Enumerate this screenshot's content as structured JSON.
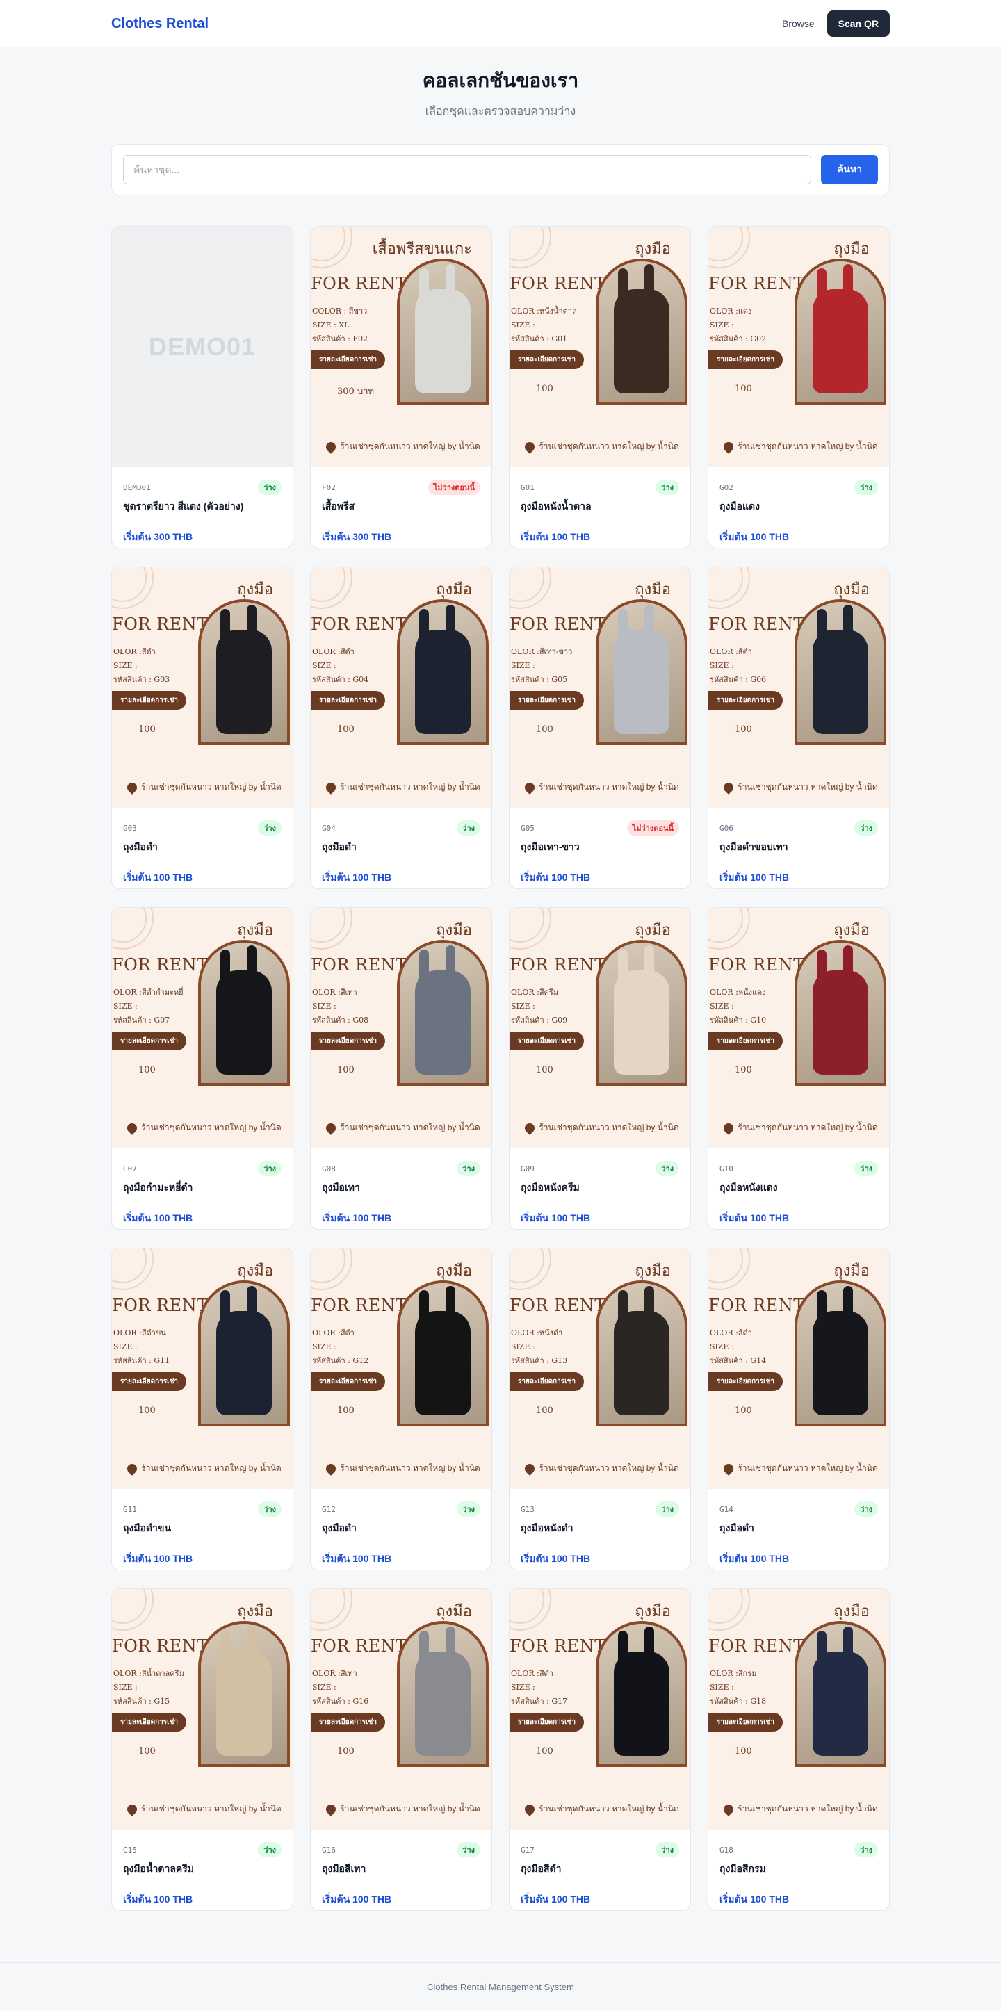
{
  "header": {
    "brand": "Clothes Rental",
    "browse_label": "Browse",
    "scan_label": "Scan QR"
  },
  "hero": {
    "title": "คอลเลกชันของเรา",
    "subtitle": "เลือกชุดและตรวจสอบความว่าง"
  },
  "search": {
    "placeholder": "ค้นหาชุด...",
    "button_label": "ค้นหา"
  },
  "poster": {
    "for_rent": "FOR RENT",
    "pill": "รายละเอียดการเช่า",
    "shop": "ร้านเช่าชุดกันหนาว หาดใหญ่ by น้ำนิด",
    "title_gloves": "ถุงมือ"
  },
  "items": [
    {
      "code": "DEMO01",
      "name": "ชุดราตรียาว สีแดง (ตัวอย่าง)",
      "status": "ว่าง",
      "available": true,
      "price": "เริ่มต้น 300 THB",
      "demo": true,
      "demo_text": "DEMO01"
    },
    {
      "code": "F02",
      "name": "เสื้อพรีส",
      "status": "ไม่ว่างตอนนี้",
      "available": false,
      "price": "เริ่มต้น 300 THB",
      "poster_title": "เสื้อพรีสขนแกะ",
      "color": "#d9d9d6",
      "poster_lines": [
        "COLOR : สีขาว",
        "SIZE : XL",
        "รหัสสินค้า : F02"
      ],
      "poster_price": "300 บาท"
    },
    {
      "code": "G01",
      "name": "ถุงมือหนังน้ำตาล",
      "status": "ว่าง",
      "available": true,
      "price": "เริ่มต้น 100 THB",
      "color": "#3b2a22",
      "poster_lines": [
        "OLOR :หนังน้ำตาล",
        "SIZE :",
        "รหัสสินค้า : G01"
      ],
      "poster_price": "100"
    },
    {
      "code": "G02",
      "name": "ถุงมือแดง",
      "status": "ว่าง",
      "available": true,
      "price": "เริ่มต้น 100 THB",
      "color": "#b3262b",
      "poster_lines": [
        "OLOR :แดง",
        "SIZE :",
        "รหัสสินค้า : G02"
      ],
      "poster_price": "100"
    },
    {
      "code": "G03",
      "name": "ถุงมือดำ",
      "status": "ว่าง",
      "available": true,
      "price": "เริ่มต้น 100 THB",
      "color": "#1e1e22",
      "poster_lines": [
        "OLOR :สีดำ",
        "SIZE :",
        "รหัสสินค้า : G03"
      ],
      "poster_price": "100"
    },
    {
      "code": "G04",
      "name": "ถุงมือดำ",
      "status": "ว่าง",
      "available": true,
      "price": "เริ่มต้น 100 THB",
      "color": "#1c2230",
      "poster_lines": [
        "OLOR :สีดำ",
        "SIZE :",
        "รหัสสินค้า : G04"
      ],
      "poster_price": "100"
    },
    {
      "code": "G05",
      "name": "ถุงมือเทา-ขาว",
      "status": "ไม่ว่างตอนนี้",
      "available": false,
      "price": "เริ่มต้น 100 THB",
      "color": "#b9bcc2",
      "poster_lines": [
        "OLOR :สีเทา-ขาว",
        "SIZE :",
        "รหัสสินค้า : G05"
      ],
      "poster_price": "100"
    },
    {
      "code": "G06",
      "name": "ถุงมือดำขอบเทา",
      "status": "ว่าง",
      "available": true,
      "price": "เริ่มต้น 100 THB",
      "color": "#1f2433",
      "poster_lines": [
        "OLOR :สีดำ",
        "SIZE :",
        "รหัสสินค้า : G06"
      ],
      "poster_price": "100"
    },
    {
      "code": "G07",
      "name": "ถุงมือกำมะหยี่ดำ",
      "status": "ว่าง",
      "available": true,
      "price": "เริ่มต้น 100 THB",
      "color": "#15161a",
      "poster_lines": [
        "OLOR :สีดำกำมะหยี่",
        "SIZE :",
        "รหัสสินค้า : G07"
      ],
      "poster_price": "100"
    },
    {
      "code": "G08",
      "name": "ถุงมือเทา",
      "status": "ว่าง",
      "available": true,
      "price": "เริ่มต้น 100 THB",
      "color": "#6b7280",
      "poster_lines": [
        "OLOR :สีเทา",
        "SIZE :",
        "รหัสสินค้า : G08"
      ],
      "poster_price": "100"
    },
    {
      "code": "G09",
      "name": "ถุงมือหนังครีม",
      "status": "ว่าง",
      "available": true,
      "price": "เริ่มต้น 100 THB",
      "color": "#e4d6c4",
      "poster_lines": [
        "OLOR :สีครีม",
        "SIZE :",
        "รหัสสินค้า : G09"
      ],
      "poster_price": "100"
    },
    {
      "code": "G10",
      "name": "ถุงมือหนังแดง",
      "status": "ว่าง",
      "available": true,
      "price": "เริ่มต้น 100 THB",
      "color": "#8d1f2d",
      "poster_lines": [
        "OLOR :หนังแดง",
        "SIZE :",
        "รหัสสินค้า : G10"
      ],
      "poster_price": "100"
    },
    {
      "code": "G11",
      "name": "ถุงมือดำขน",
      "status": "ว่าง",
      "available": true,
      "price": "เริ่มต้น 100 THB",
      "color": "#1d2233",
      "poster_lines": [
        "OLOR :สีดำขน",
        "SIZE :",
        "รหัสสินค้า : G11"
      ],
      "poster_price": "100"
    },
    {
      "code": "G12",
      "name": "ถุงมือดำ",
      "status": "ว่าง",
      "available": true,
      "price": "เริ่มต้น 100 THB",
      "color": "#141414",
      "poster_lines": [
        "OLOR :สีดำ",
        "SIZE :",
        "รหัสสินค้า : G12"
      ],
      "poster_price": "100"
    },
    {
      "code": "G13",
      "name": "ถุงมือหนังดำ",
      "status": "ว่าง",
      "available": true,
      "price": "เริ่มต้น 100 THB",
      "color": "#2a2624",
      "poster_lines": [
        "OLOR :หนังดำ",
        "SIZE :",
        "รหัสสินค้า : G13"
      ],
      "poster_price": "100"
    },
    {
      "code": "G14",
      "name": "ถุงมือดำ",
      "status": "ว่าง",
      "available": true,
      "price": "เริ่มต้น 100 THB",
      "color": "#15171c",
      "poster_lines": [
        "OLOR :สีดำ",
        "SIZE :",
        "รหัสสินค้า : G14"
      ],
      "poster_price": "100"
    },
    {
      "code": "G15",
      "name": "ถุงมือน้ำตาลครีม",
      "status": "ว่าง",
      "available": true,
      "price": "เริ่มต้น 100 THB",
      "color": "#d2c0a4",
      "poster_lines": [
        "OLOR :สีน้ำตาลครีม",
        "SIZE :",
        "รหัสสินค้า : G15"
      ],
      "poster_price": "100"
    },
    {
      "code": "G16",
      "name": "ถุงมือสีเทา",
      "status": "ว่าง",
      "available": true,
      "price": "เริ่มต้น 100 THB",
      "color": "#8a8b90",
      "poster_lines": [
        "OLOR :สีเทา",
        "SIZE :",
        "รหัสสินค้า : G16"
      ],
      "poster_price": "100"
    },
    {
      "code": "G17",
      "name": "ถุงมือสีดำ",
      "status": "ว่าง",
      "available": true,
      "price": "เริ่มต้น 100 THB",
      "color": "#111318",
      "poster_lines": [
        "OLOR :สีดำ",
        "SIZE :",
        "รหัสสินค้า : G17"
      ],
      "poster_price": "100"
    },
    {
      "code": "G18",
      "name": "ถุงมือสีกรม",
      "status": "ว่าง",
      "available": true,
      "price": "เริ่มต้น 100 THB",
      "color": "#232a44",
      "poster_lines": [
        "OLOR :สีกรม",
        "SIZE :",
        "รหัสสินค้า : G18"
      ],
      "poster_price": "100"
    }
  ],
  "footer": {
    "text": "Clothes Rental Management System"
  }
}
